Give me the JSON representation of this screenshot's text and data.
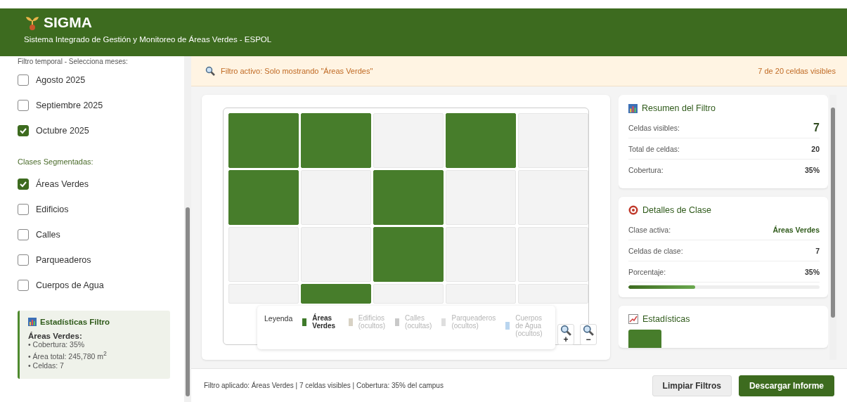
{
  "header": {
    "title": "SIGMA",
    "subtitle": "Sistema Integrado de Gestión y Monitoreo de Áreas Verdes - ESPOL"
  },
  "sidebar": {
    "months_label": "Filtro temporal - Selecciona meses:",
    "months": [
      {
        "label": "Agosto 2025",
        "checked": false
      },
      {
        "label": "Septiembre 2025",
        "checked": false
      },
      {
        "label": "Octubre 2025",
        "checked": true
      }
    ],
    "classes_label": "Clases Segmentadas:",
    "classes": [
      {
        "label": "Áreas Verdes",
        "checked": true
      },
      {
        "label": "Edificios",
        "checked": false
      },
      {
        "label": "Calles",
        "checked": false
      },
      {
        "label": "Parqueaderos",
        "checked": false
      },
      {
        "label": "Cuerpos de Agua",
        "checked": false
      }
    ],
    "stats": {
      "title": "Estadísticas Filtro",
      "heading": "Áreas Verdes:",
      "lines": [
        "• Cobertura: 35%",
        "• Área total: 245,780 m$^{2}$",
        "• Celdas: 7"
      ]
    }
  },
  "filter_bar": {
    "text": "Filtro activo: Solo mostrando \"Áreas Verdes\"",
    "count": "7 de 20 celdas visibles"
  },
  "map": {
    "cells": [
      {
        "filled": true
      },
      {
        "filled": true
      },
      {
        "filled": false
      },
      {
        "filled": true
      },
      {
        "filled": false
      },
      {
        "filled": true
      },
      {
        "filled": false
      },
      {
        "filled": true
      },
      {
        "filled": false
      },
      {
        "filled": false
      },
      {
        "filled": false
      },
      {
        "filled": false
      },
      {
        "filled": true
      },
      {
        "filled": false
      },
      {
        "filled": false
      },
      {
        "filled": false
      },
      {
        "filled": true
      },
      {
        "filled": false
      },
      {
        "filled": false
      },
      {
        "filled": false
      }
    ],
    "legend": {
      "title": "Leyenda",
      "items": [
        {
          "label": "Áreas Verdes",
          "hidden": false,
          "color": "#3f7a2a"
        },
        {
          "label": "Edificios",
          "note": "(ocultos)",
          "hidden": true,
          "color": "#d8d2c4"
        },
        {
          "label": "Calles",
          "note": "(ocultas)",
          "hidden": true,
          "color": "#c9c9c9"
        },
        {
          "label": "Parqueaderos",
          "note": "(ocultos)",
          "hidden": true,
          "color": "#dedede"
        },
        {
          "label": "Cuerpos de Agua",
          "note": "(ocultos)",
          "hidden": true,
          "color": "#b9d5ef"
        }
      ]
    },
    "zoom_buttons": [
      "+",
      "−"
    ]
  },
  "summary": {
    "title": "Resumen del Filtro",
    "rows": [
      {
        "label": "Celdas visibles:",
        "value": "7",
        "kind": "big"
      },
      {
        "label": "Total de celdas:",
        "value": "20",
        "kind": "plain"
      },
      {
        "label": "Cobertura:",
        "value": "35%",
        "kind": "plain"
      }
    ]
  },
  "class_details": {
    "title": "Detalles de Clase",
    "rows": [
      {
        "label": "Clase activa:",
        "value": "Áreas Verdes",
        "kind": "accent"
      },
      {
        "label": "Celdas de clase:",
        "value": "7",
        "kind": "plain"
      },
      {
        "label": "Porcentaje:",
        "value": "35%",
        "kind": "plain"
      }
    ],
    "level": 0.35
  },
  "statistics": {
    "title": "Estadísticas"
  },
  "footer": {
    "text": "Filtro aplicado: Áreas Verdes | 7 celdas visibles | Cobertura: 35% del campus",
    "buttons": [
      {
        "label": "Limpiar Filtros",
        "kind": "secondary"
      },
      {
        "label": "Descargar Informe",
        "kind": "primary"
      }
    ]
  }
}
